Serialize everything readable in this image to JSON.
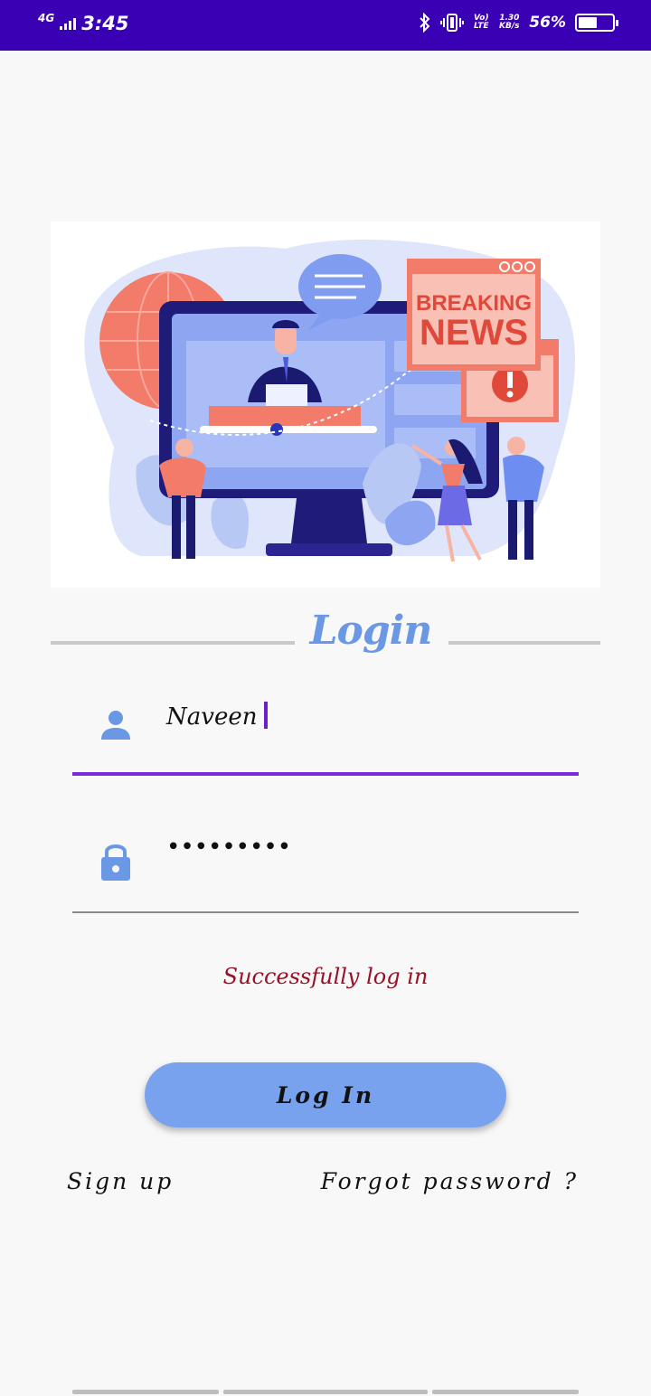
{
  "status_bar": {
    "network": "4G",
    "time": "3:45",
    "volte": "Vo) LTE",
    "speed": "1.30 KB/s",
    "battery_percent": "56%",
    "battery_level": 0.56,
    "icons": [
      "signal-icon",
      "bluetooth-icon",
      "vibrate-icon",
      "battery-icon"
    ]
  },
  "hero": {
    "image_name": "news-illustration",
    "sign_line1": "BREAKING",
    "sign_line2": "NEWS",
    "colors": {
      "blue": "#6d8ef0",
      "coral": "#f27b6a",
      "navy": "#1a1a70",
      "pale": "#dfe6fb"
    }
  },
  "login": {
    "title": "Login",
    "username_icon": "person-icon",
    "username_value": "Naveen",
    "password_icon": "lock-icon",
    "password_value": "•••••••••",
    "message": "Successfully log in",
    "button_label": "Log In",
    "signup_label": "Sign up",
    "forgot_label": "Forgot password ?"
  },
  "colors": {
    "status_bar": "#3a00b4",
    "accent": "#7a2ad6",
    "title": "#6a98e4",
    "button": "#78a2ee",
    "message": "#9a1025"
  }
}
